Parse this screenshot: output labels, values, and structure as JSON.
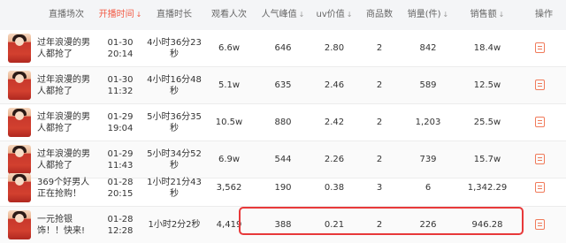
{
  "header": {
    "columns": [
      "直播场次",
      "开播时间",
      "直播时长",
      "观看人次",
      "人气峰值",
      "uv价值",
      "商品数",
      "销量(件)",
      "销售额",
      "操作"
    ],
    "sort_icon": "↓"
  },
  "rows": [
    {
      "title": "过年浪漫的男人都抢了",
      "date": "01-30",
      "time": "20:14",
      "duration": "4小时36分23秒",
      "views": "6.6w",
      "peak": "646",
      "uv": "2.80",
      "goods": "2",
      "sales": "842",
      "revenue": "18.4w"
    },
    {
      "title": "过年浪漫的男人都抢了",
      "date": "01-30",
      "time": "11:32",
      "duration": "4小时16分48秒",
      "views": "5.1w",
      "peak": "635",
      "uv": "2.46",
      "goods": "2",
      "sales": "589",
      "revenue": "12.5w"
    },
    {
      "title": "过年浪漫的男人都抢了",
      "date": "01-29",
      "time": "19:04",
      "duration": "5小时36分35秒",
      "views": "10.5w",
      "peak": "880",
      "uv": "2.42",
      "goods": "2",
      "sales": "1,203",
      "revenue": "25.5w"
    },
    {
      "title": "过年浪漫的男人都抢了",
      "date": "01-29",
      "time": "11:43",
      "duration": "5小时34分52秒",
      "views": "6.9w",
      "peak": "544",
      "uv": "2.26",
      "goods": "2",
      "sales": "739",
      "revenue": "15.7w"
    },
    {
      "title": "369个好男人正在抢购！",
      "date": "01-28",
      "time": "20:15",
      "duration": "1小时21分43秒",
      "views": "3,562",
      "peak": "190",
      "uv": "0.38",
      "goods": "3",
      "sales": "6",
      "revenue": "1,342.29"
    },
    {
      "title": "一元抢银饰！！快来!",
      "date": "01-28",
      "time": "12:28",
      "duration": "1小时2分2秒",
      "views": "4,419",
      "peak": "388",
      "uv": "0.21",
      "goods": "2",
      "sales": "226",
      "revenue": "946.28"
    }
  ],
  "colors": {
    "accent": "#f25a44",
    "highlight": "#e8393a"
  },
  "icons": {
    "thumbnail": "live-cover-thumbnail",
    "action": "detail-icon"
  }
}
